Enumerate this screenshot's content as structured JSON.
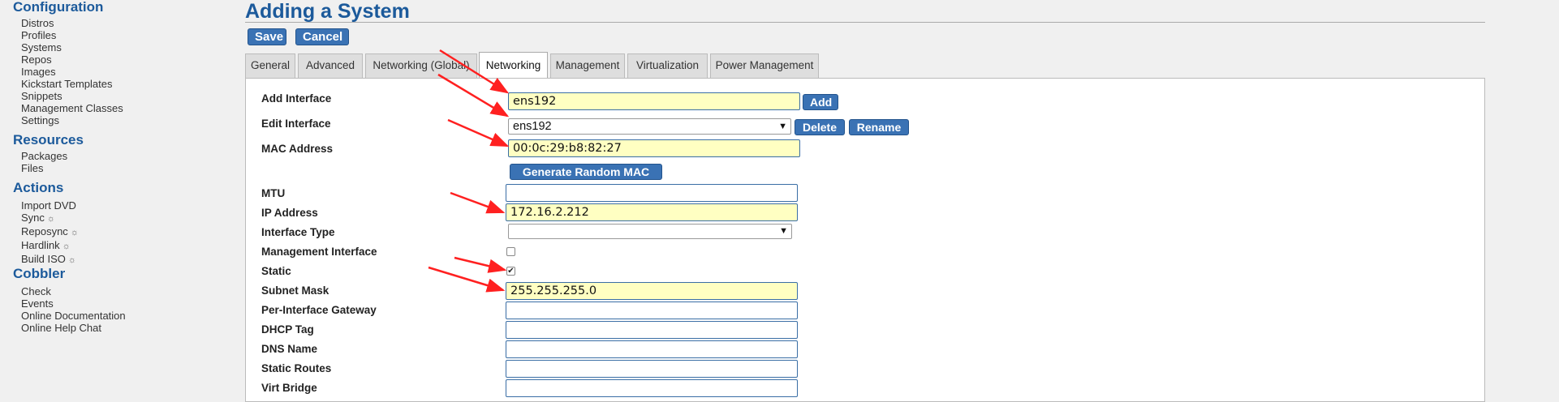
{
  "sidebar": {
    "sections": [
      {
        "title": "Configuration",
        "items": [
          "Distros",
          "Profiles",
          "Systems",
          "Repos",
          "Images",
          "Kickstart Templates",
          "Snippets",
          "Management Classes",
          "Settings"
        ]
      },
      {
        "title": "Resources",
        "items": [
          "Packages",
          "Files"
        ]
      },
      {
        "title": "Actions",
        "items": [
          "Import DVD",
          "Sync",
          "Reposync",
          "Hardlink",
          "Build ISO"
        ]
      },
      {
        "title": "Cobbler",
        "items": [
          "Check",
          "Events",
          "Online Documentation",
          "Online Help Chat"
        ]
      }
    ],
    "spinner_glyph": "☼"
  },
  "page": {
    "title": "Adding a System"
  },
  "buttons": {
    "save": "Save",
    "cancel": "Cancel"
  },
  "tabs": [
    "General",
    "Advanced",
    "Networking (Global)",
    "Networking",
    "Management",
    "Virtualization",
    "Power Management"
  ],
  "active_tab": "Networking",
  "form": {
    "add_interface": {
      "label": "Add Interface",
      "value": "ens192",
      "button": "Add"
    },
    "edit_interface": {
      "label": "Edit Interface",
      "value": "ens192",
      "delete": "Delete",
      "rename": "Rename"
    },
    "mac_address": {
      "label": "MAC Address",
      "value": "00:0c:29:b8:82:27",
      "button": "Generate Random MAC"
    },
    "mtu": {
      "label": "MTU",
      "value": ""
    },
    "ip_address": {
      "label": "IP Address",
      "value": "172.16.2.212"
    },
    "interface_type": {
      "label": "Interface Type",
      "value": ""
    },
    "management_interface": {
      "label": "Management Interface",
      "checked": false
    },
    "static": {
      "label": "Static",
      "checked": true
    },
    "subnet_mask": {
      "label": "Subnet Mask",
      "value": "255.255.255.0"
    },
    "per_interface_gateway": {
      "label": "Per-Interface Gateway",
      "value": ""
    },
    "dhcp_tag": {
      "label": "DHCP Tag",
      "value": ""
    },
    "dns_name": {
      "label": "DNS Name",
      "value": ""
    },
    "static_routes": {
      "label": "Static Routes",
      "value": ""
    },
    "virt_bridge": {
      "label": "Virt Bridge",
      "value": ""
    }
  },
  "colors": {
    "accent": "#1c5a9b",
    "button": "#3a72b4",
    "highlight": "#ffffc2",
    "annotation_arrow": "#ff2020"
  }
}
